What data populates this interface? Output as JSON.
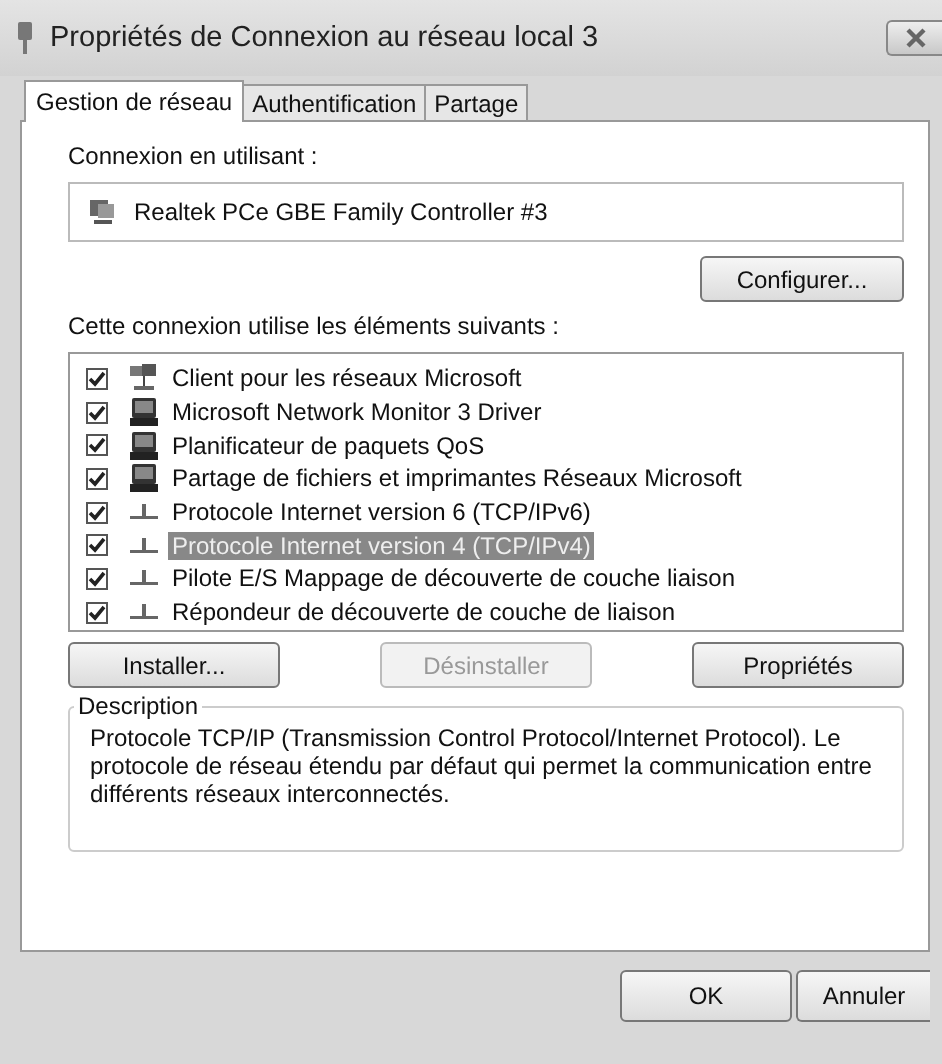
{
  "window": {
    "title": "Propriétés de Connexion au réseau local 3"
  },
  "tabs": [
    {
      "label": "Gestion de réseau",
      "selected": true
    },
    {
      "label": "Authentification",
      "selected": false
    },
    {
      "label": "Partage",
      "selected": false
    }
  ],
  "connection": {
    "label": "Connexion en utilisant :",
    "adapter": "Realtek PCe GBE Family Controller #3",
    "configure_button": "Configurer..."
  },
  "components": {
    "label": "Cette connexion utilise les éléments suivants :",
    "items": [
      {
        "name": "Client pour les réseaux Microsoft",
        "checked": true,
        "selected": false,
        "kind": "client"
      },
      {
        "name": "Microsoft Network Monitor 3 Driver",
        "checked": true,
        "selected": false,
        "kind": "service"
      },
      {
        "name": "Planificateur de paquets QoS",
        "checked": true,
        "selected": false,
        "kind": "service"
      },
      {
        "name": "Partage de fichiers et imprimantes Réseaux Microsoft",
        "checked": true,
        "selected": false,
        "kind": "service"
      },
      {
        "name": "Protocole Internet version 6 (TCP/IPv6)",
        "checked": true,
        "selected": false,
        "kind": "protocol"
      },
      {
        "name": "Protocole Internet version 4 (TCP/IPv4)",
        "checked": true,
        "selected": true,
        "kind": "protocol"
      },
      {
        "name": "Pilote E/S Mappage de découverte de couche liaison",
        "checked": true,
        "selected": false,
        "kind": "protocol"
      },
      {
        "name": "Répondeur de découverte de couche de liaison",
        "checked": true,
        "selected": false,
        "kind": "protocol"
      }
    ]
  },
  "actions": [
    {
      "label": "Installer...",
      "disabled": false
    },
    {
      "label": "Désinstaller",
      "disabled": true
    },
    {
      "label": "Propriétés",
      "disabled": false
    }
  ],
  "description": {
    "title": "Description",
    "text": "Protocole TCP/IP (Transmission Control Protocol/Internet Protocol). Le protocole de réseau étendu par défaut qui permet la communication entre différents réseaux interconnectés."
  },
  "buttons": [
    {
      "label": "OK"
    },
    {
      "label": "Annuler"
    }
  ]
}
